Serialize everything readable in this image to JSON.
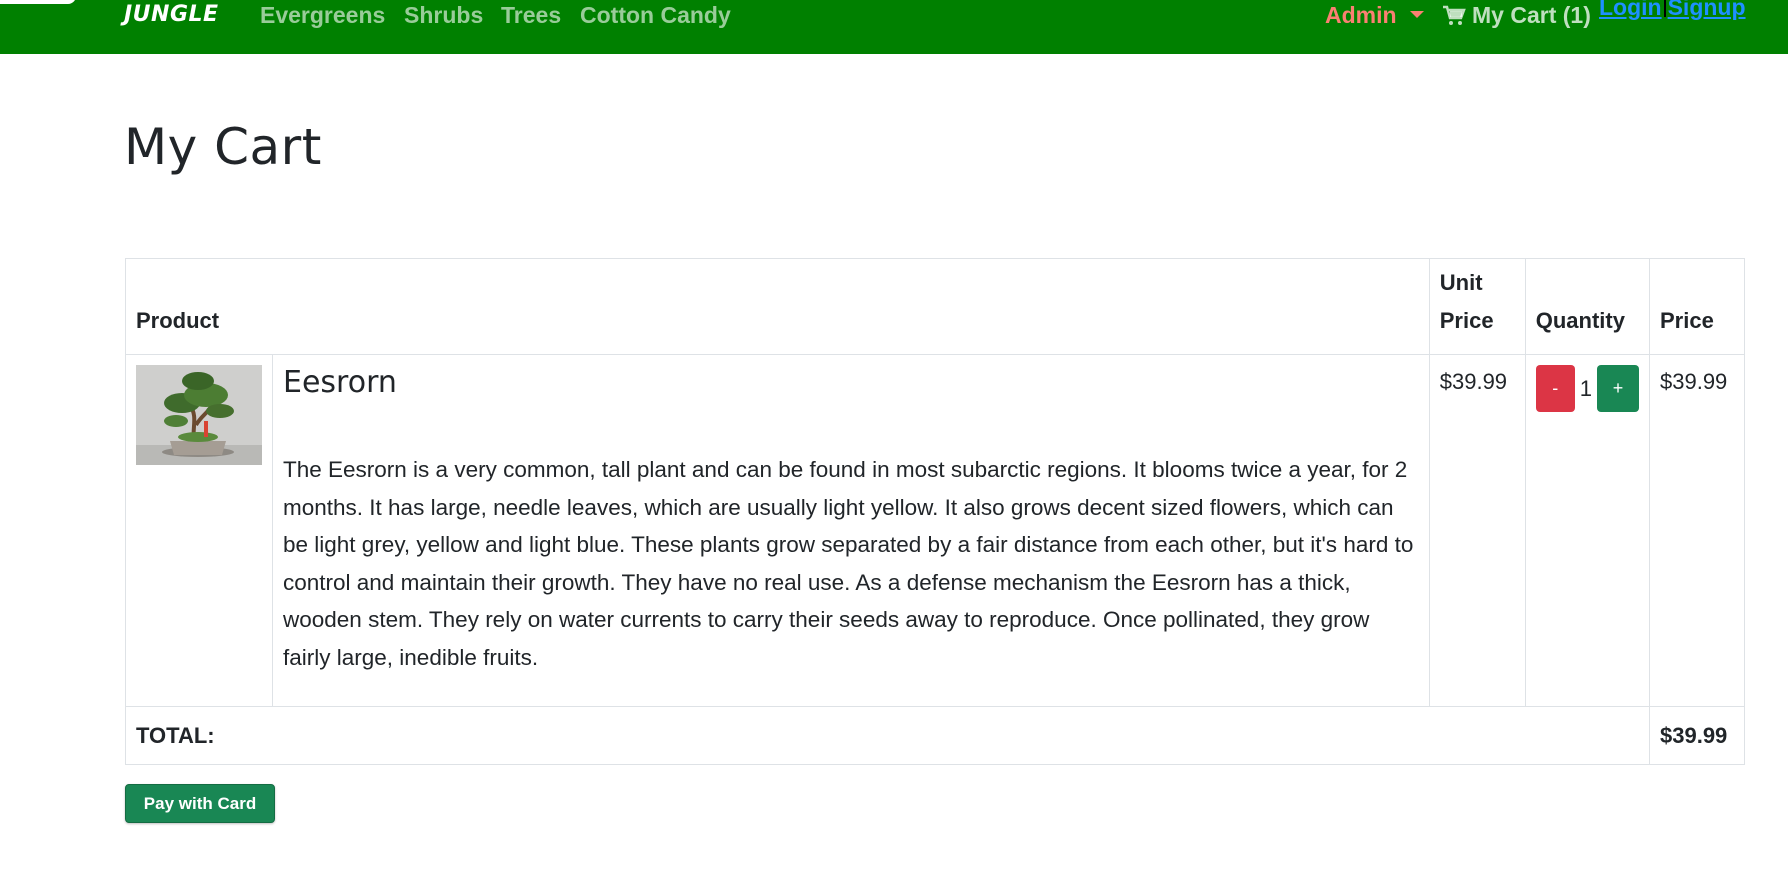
{
  "navbar": {
    "brand": "JUNGLE",
    "links": [
      {
        "label": "Evergreens"
      },
      {
        "label": "Shrubs"
      },
      {
        "label": "Trees"
      },
      {
        "label": "Cotton Candy"
      }
    ],
    "admin_label": "Admin",
    "cart_label": "My Cart (1)",
    "login_label": "Login",
    "signup_label": "Signup"
  },
  "page": {
    "title": "My Cart"
  },
  "table": {
    "headers": {
      "product": "Product",
      "unit_price": "Unit Price",
      "quantity": "Quantity",
      "price": "Price"
    },
    "items": [
      {
        "name": "Eesrorn",
        "description": "The Eesrorn is a very common, tall plant and can be found in most subarctic regions. It blooms twice a year, for 2 months. It has large, needle leaves, which are usually light yellow. It also grows decent sized flowers, which can be light grey, yellow and light blue. These plants grow separated by a fair distance from each other, but it's hard to control and maintain their growth. They have no real use. As a defense mechanism the Eesrorn has a thick, wooden stem. They rely on water currents to carry their seeds away to reproduce. Once pollinated, they grow fairly large, inedible fruits.",
        "unit_price": "$39.99",
        "quantity": "1",
        "decrement_label": "-",
        "increment_label": "+",
        "price": "$39.99"
      }
    ],
    "total_label": "TOTAL:",
    "total_value": "$39.99"
  },
  "pay_button_label": "Pay with Card",
  "colors": {
    "navbar_bg": "#008000",
    "admin_link": "#fa8072",
    "auth_link": "#1e90ff",
    "minus_button": "#dc3545",
    "plus_button": "#198754",
    "pay_button": "#198754"
  },
  "icons": {
    "cart": "shopping-cart-icon",
    "dropdown": "caret-down-icon"
  }
}
